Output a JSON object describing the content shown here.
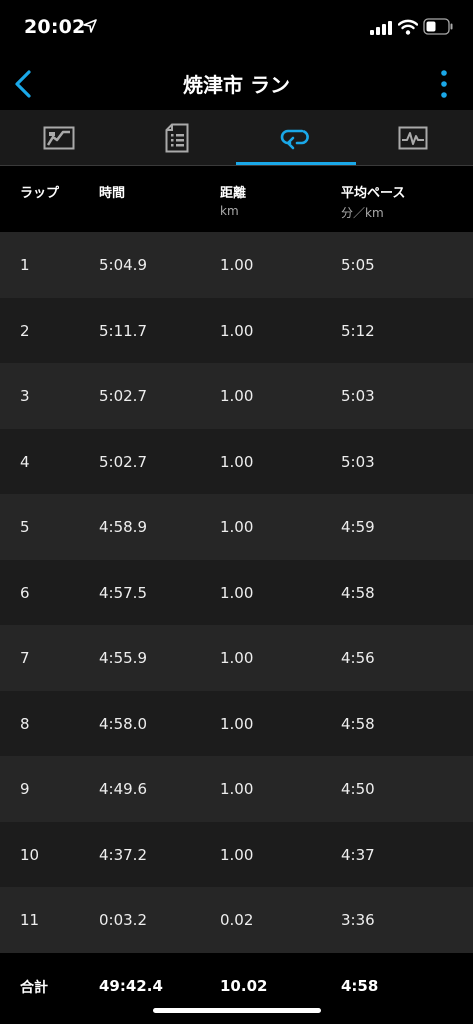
{
  "status_bar": {
    "time": "20:02"
  },
  "nav": {
    "title": "焼津市 ラン"
  },
  "tabs": [
    {
      "icon": "map-icon"
    },
    {
      "icon": "details-icon"
    },
    {
      "icon": "laps-icon",
      "active": true
    },
    {
      "icon": "chart-icon"
    }
  ],
  "accent_color": "#1aa8e8",
  "table": {
    "headers": {
      "lap": "ラップ",
      "time": "時間",
      "distance": "距離",
      "distance_unit": "km",
      "pace": "平均ペース",
      "pace_unit": "分／km"
    },
    "rows": [
      {
        "lap": "1",
        "time": "5:04.9",
        "distance": "1.00",
        "pace": "5:05"
      },
      {
        "lap": "2",
        "time": "5:11.7",
        "distance": "1.00",
        "pace": "5:12"
      },
      {
        "lap": "3",
        "time": "5:02.7",
        "distance": "1.00",
        "pace": "5:03"
      },
      {
        "lap": "4",
        "time": "5:02.7",
        "distance": "1.00",
        "pace": "5:03"
      },
      {
        "lap": "5",
        "time": "4:58.9",
        "distance": "1.00",
        "pace": "4:59"
      },
      {
        "lap": "6",
        "time": "4:57.5",
        "distance": "1.00",
        "pace": "4:58"
      },
      {
        "lap": "7",
        "time": "4:55.9",
        "distance": "1.00",
        "pace": "4:56"
      },
      {
        "lap": "8",
        "time": "4:58.0",
        "distance": "1.00",
        "pace": "4:58"
      },
      {
        "lap": "9",
        "time": "4:49.6",
        "distance": "1.00",
        "pace": "4:50"
      },
      {
        "lap": "10",
        "time": "4:37.2",
        "distance": "1.00",
        "pace": "4:37"
      },
      {
        "lap": "11",
        "time": "0:03.2",
        "distance": "0.02",
        "pace": "3:36"
      }
    ],
    "total": {
      "label": "合計",
      "time": "49:42.4",
      "distance": "10.02",
      "pace": "4:58"
    }
  }
}
